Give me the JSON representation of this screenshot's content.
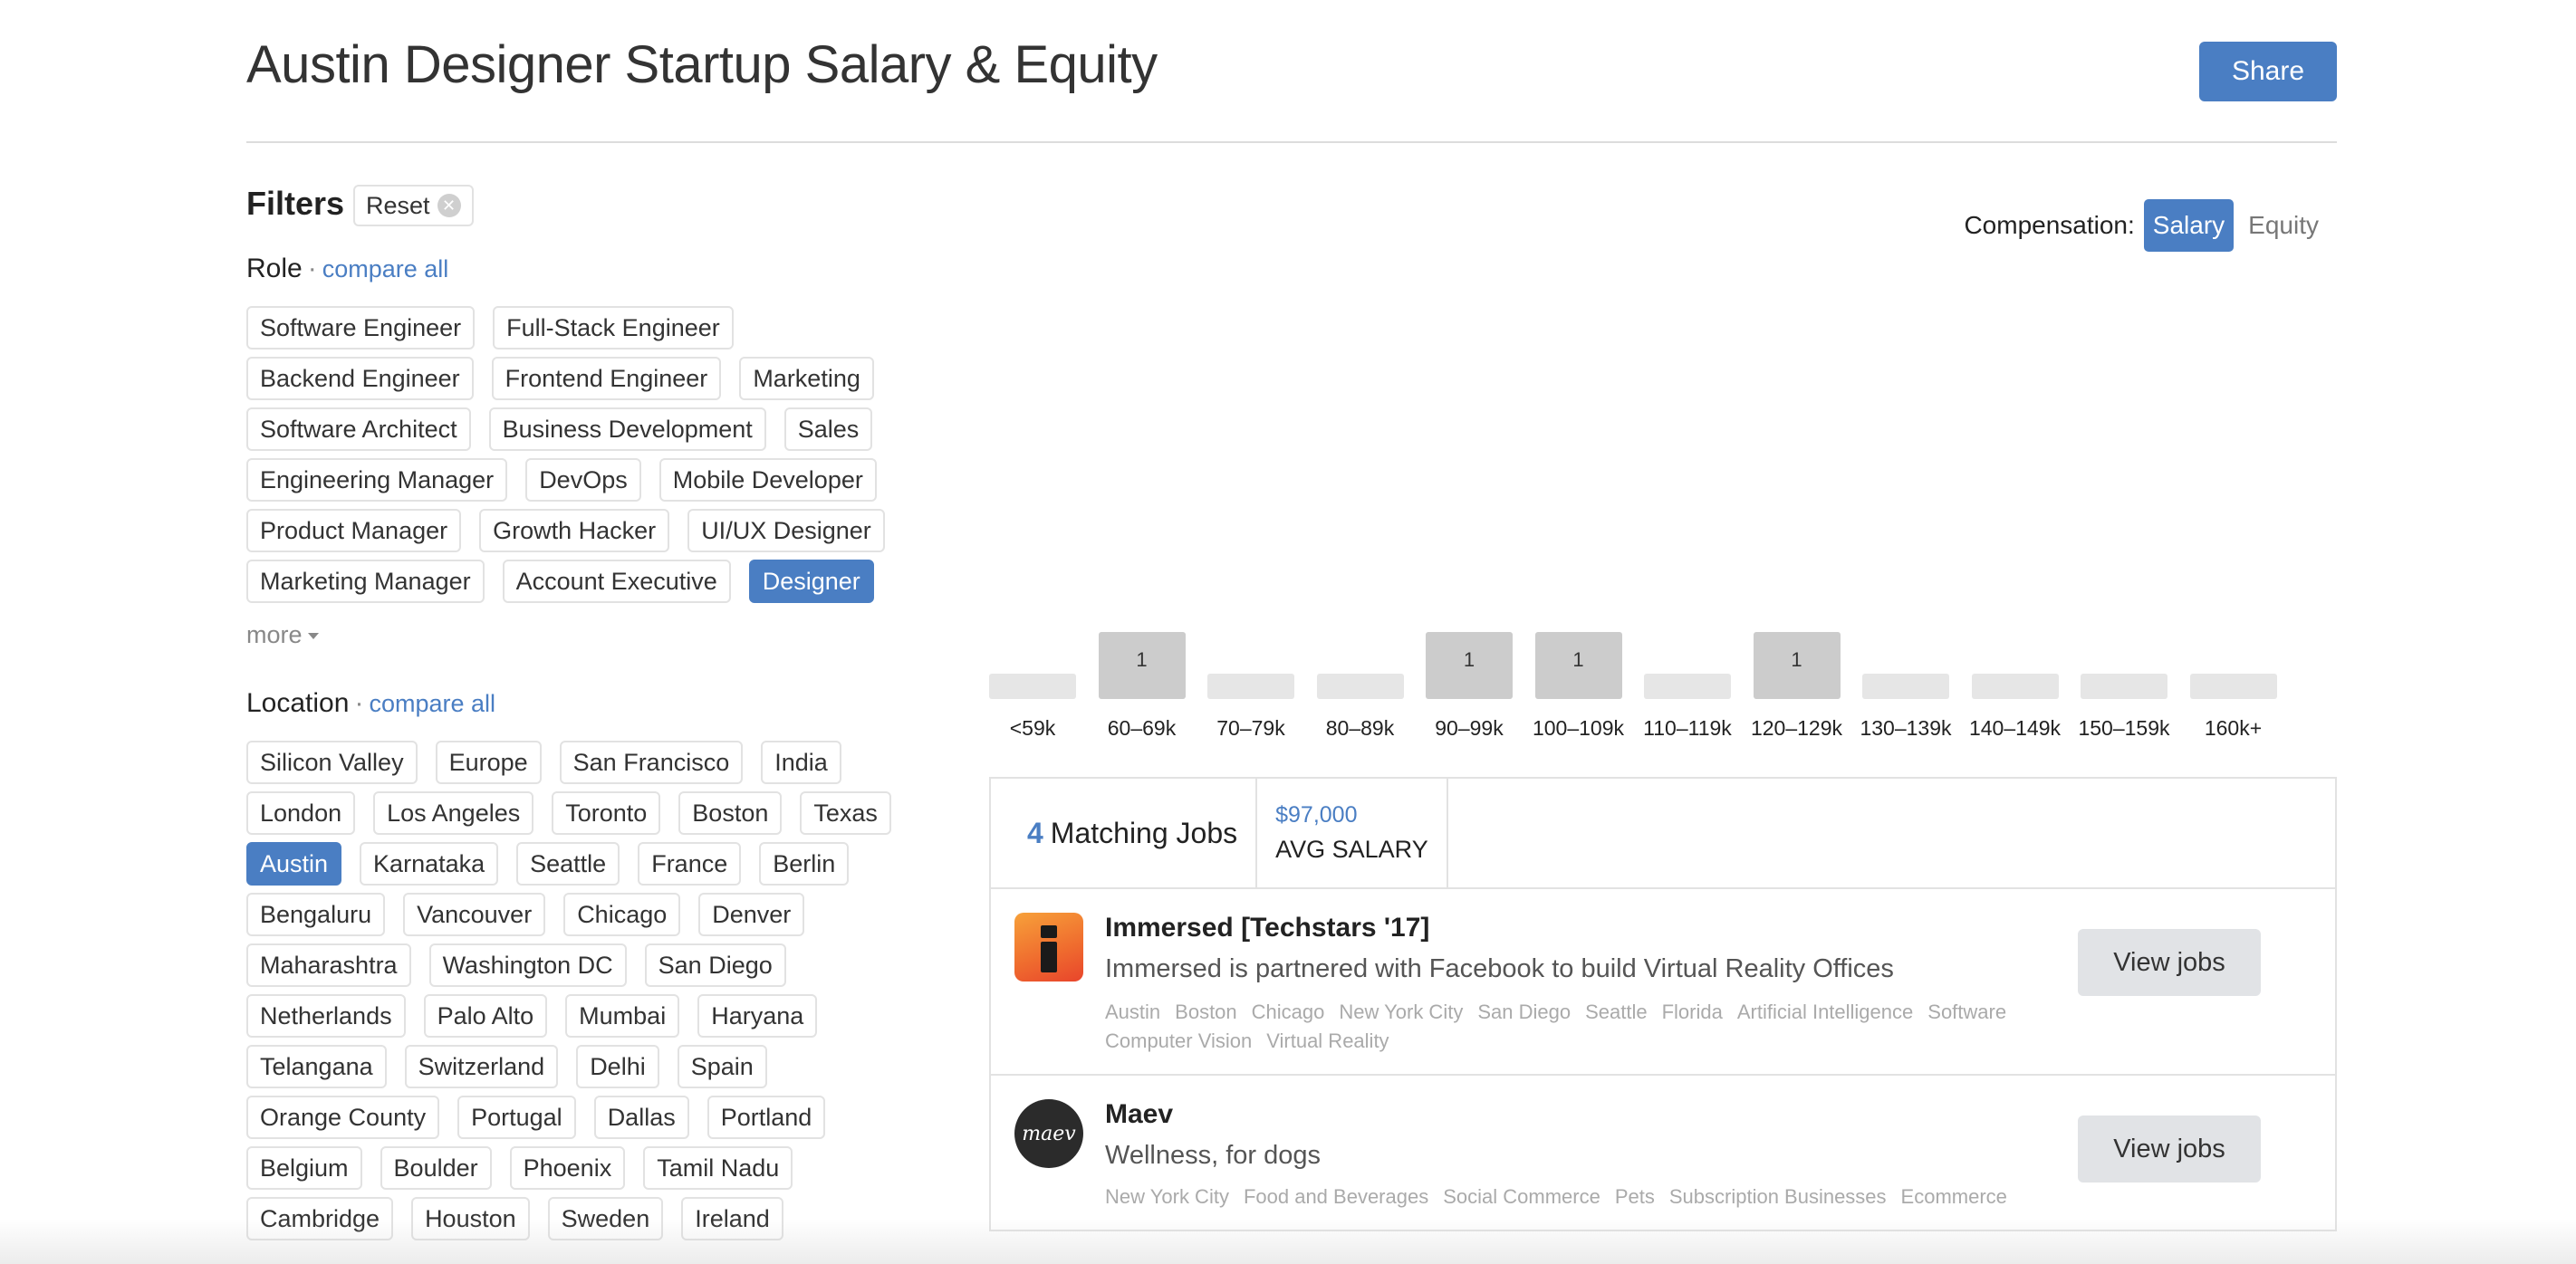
{
  "page": {
    "title": "Austin Designer Startup Salary & Equity",
    "share_label": "Share"
  },
  "filters": {
    "title": "Filters",
    "reset_label": "Reset",
    "role": {
      "heading": "Role",
      "separator": "·",
      "compare_all": "compare all",
      "rows": [
        [
          "Software Engineer",
          "Full-Stack Engineer"
        ],
        [
          "Backend Engineer",
          "Frontend Engineer",
          "Marketing"
        ],
        [
          "Software Architect",
          "Business Development",
          "Sales"
        ],
        [
          "Engineering Manager",
          "DevOps",
          "Mobile Developer"
        ],
        [
          "Product Manager",
          "Growth Hacker",
          "UI/UX Designer"
        ],
        [
          "Marketing Manager",
          "Account Executive",
          "Designer"
        ]
      ],
      "active": "Designer",
      "more_label": "more"
    },
    "location": {
      "heading": "Location",
      "separator": "·",
      "compare_all": "compare all",
      "rows": [
        [
          "Silicon Valley",
          "Europe",
          "San Francisco",
          "India"
        ],
        [
          "London",
          "Los Angeles",
          "Toronto",
          "Boston",
          "Texas"
        ],
        [
          "Austin",
          "Karnataka",
          "Seattle",
          "France",
          "Berlin"
        ],
        [
          "Bengaluru",
          "Vancouver",
          "Chicago",
          "Denver"
        ],
        [
          "Maharashtra",
          "Washington DC",
          "San Diego"
        ],
        [
          "Netherlands",
          "Palo Alto",
          "Mumbai",
          "Haryana"
        ],
        [
          "Telangana",
          "Switzerland",
          "Delhi",
          "Spain"
        ],
        [
          "Orange County",
          "Portugal",
          "Dallas",
          "Portland"
        ],
        [
          "Belgium",
          "Boulder",
          "Phoenix",
          "Tamil Nadu"
        ],
        [
          "Cambridge",
          "Houston",
          "Sweden",
          "Ireland"
        ]
      ],
      "active": "Austin"
    }
  },
  "compensation": {
    "label": "Compensation:",
    "options": [
      "Salary",
      "Equity"
    ],
    "selected": "Salary"
  },
  "chart_data": {
    "type": "bar",
    "categories": [
      "<59k",
      "60–69k",
      "70–79k",
      "80–89k",
      "90–99k",
      "100–109k",
      "110–119k",
      "120–129k",
      "130–139k",
      "140–149k",
      "150–159k",
      "160k+"
    ],
    "values": [
      0,
      1,
      0,
      0,
      1,
      1,
      0,
      1,
      0,
      0,
      0,
      0
    ],
    "title": "",
    "xlabel": "",
    "ylabel": "",
    "ylim": [
      0,
      1
    ],
    "grid": false
  },
  "summary": {
    "count": "4",
    "count_label": "Matching Jobs",
    "avg_value": "$97,000",
    "avg_label": "AVG SALARY"
  },
  "companies": [
    {
      "name": "Immersed [Techstars '17]",
      "description": "Immersed is partnered with Facebook to build Virtual Reality Offices",
      "tags": [
        "Austin",
        "Boston",
        "Chicago",
        "New York City",
        "San Diego",
        "Seattle",
        "Florida",
        "Artificial Intelligence",
        "Software",
        "Computer Vision",
        "Virtual Reality"
      ],
      "logo": "immersed-logo",
      "button_label": "View jobs"
    },
    {
      "name": "Maev",
      "description": "Wellness, for dogs",
      "tags": [
        "New York City",
        "Food and Beverages",
        "Social Commerce",
        "Pets",
        "Subscription Businesses",
        "Ecommerce"
      ],
      "logo": "maev-logo",
      "logo_text": "maev",
      "button_label": "View jobs"
    }
  ],
  "colors": {
    "accent": "#4a7ec3",
    "bar_filled": "#cccccc",
    "bar_empty": "#e6e6e6",
    "border": "#e2e2e2"
  }
}
